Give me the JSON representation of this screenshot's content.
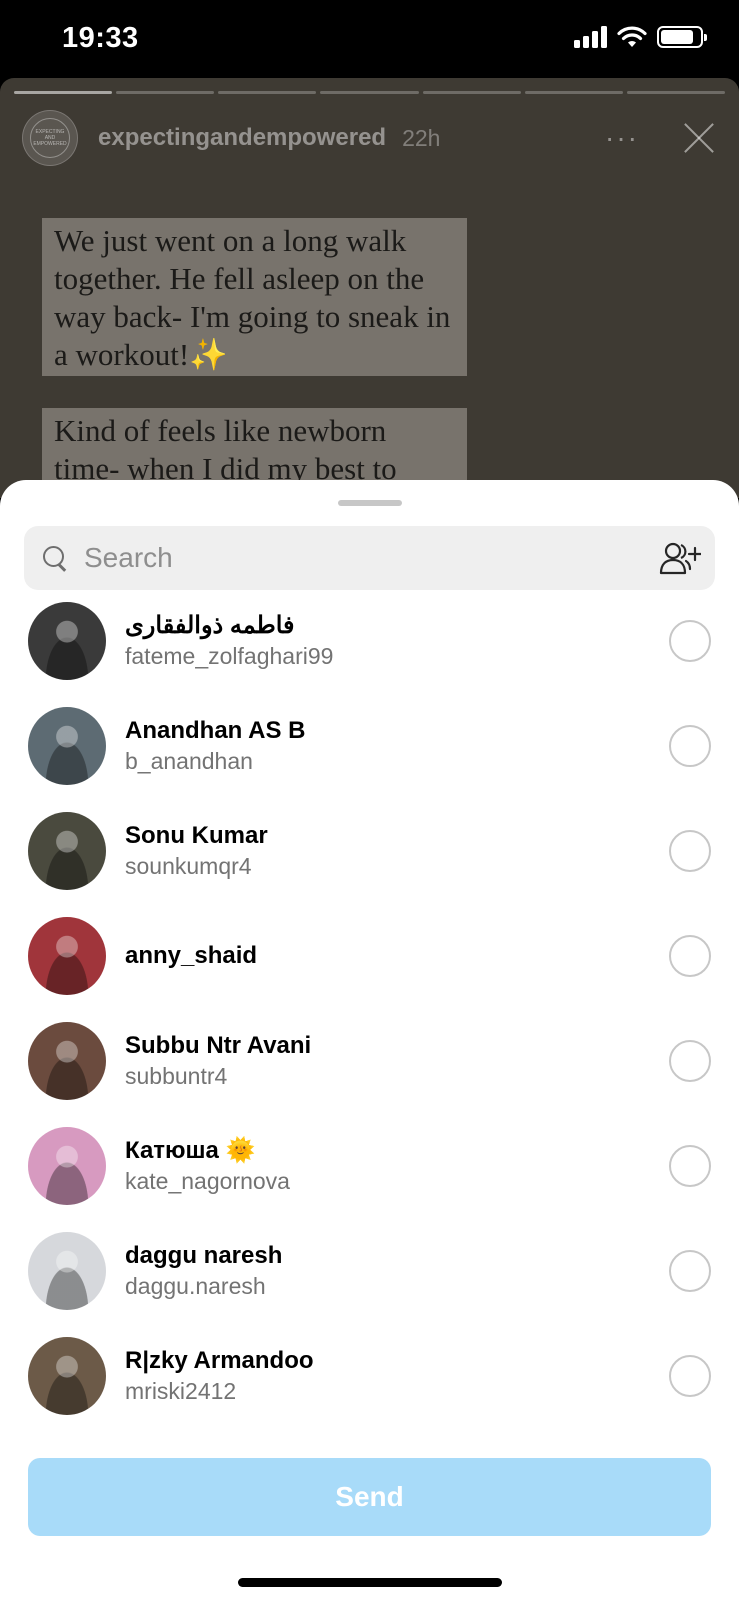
{
  "status_bar": {
    "time": "19:33",
    "battery_level": 0.85
  },
  "story": {
    "username": "expectingandempowered",
    "time_ago": "22h",
    "more_label": "···",
    "avatar_text": "EXPECTING AND EMPOWERED",
    "text_blocks": [
      "We just went on a long walk together. He fell asleep on the way back- I'm going to sneak in a workout!✨",
      "Kind of feels like newborn time- when I did my best to"
    ],
    "progress_segments": 7,
    "progress_done": 1
  },
  "share_sheet": {
    "search_placeholder": "Search",
    "contacts": [
      {
        "name": "فاطمه ذوالفقاری",
        "username": "fateme_zolfaghari99",
        "avatar_color": "#3a3a3a"
      },
      {
        "name": "Anandhan AS B",
        "username": "b_anandhan",
        "avatar_color": "#5d6b73"
      },
      {
        "name": "Sonu Kumar",
        "username": "sounkumqr4",
        "avatar_color": "#4a4a3e"
      },
      {
        "name": "anny_shaid",
        "username": "",
        "avatar_color": "#a0353b"
      },
      {
        "name": "Subbu Ntr Avani",
        "username": "subbuntr4",
        "avatar_color": "#6b4b3e"
      },
      {
        "name": "Катюша 🌞",
        "username": "kate_nagornova",
        "avatar_color": "#d79ac0"
      },
      {
        "name": "daggu naresh",
        "username": "daggu.naresh",
        "avatar_color": "#d6d8dc"
      },
      {
        "name": "R|zky Armandoo",
        "username": "mriski2412",
        "avatar_color": "#6c5a48"
      }
    ],
    "send_label": "Send"
  }
}
